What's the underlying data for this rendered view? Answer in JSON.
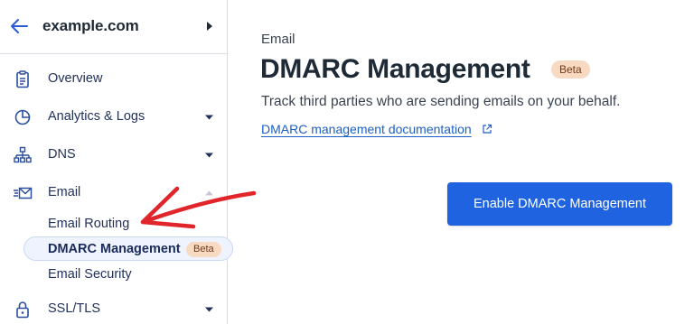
{
  "sidebar": {
    "account_name": "example.com",
    "icons": {
      "back": "arrow-left-icon",
      "switch": "caret-right-icon"
    },
    "items": [
      {
        "id": "overview",
        "label": "Overview",
        "icon": "clipboard-icon",
        "has_chevron": false
      },
      {
        "id": "analytics",
        "label": "Analytics & Logs",
        "icon": "pie-chart-icon",
        "has_chevron": true
      },
      {
        "id": "dns",
        "label": "DNS",
        "icon": "network-icon",
        "has_chevron": true
      },
      {
        "id": "email",
        "label": "Email",
        "icon": "envelope-icon",
        "has_chevron": true,
        "expanded": true
      },
      {
        "id": "ssl",
        "label": "SSL/TLS",
        "icon": "lock-icon",
        "has_chevron": true
      }
    ],
    "email_subitems": [
      {
        "label": "Email Routing",
        "active": false
      },
      {
        "label": "DMARC Management",
        "active": true,
        "badge": "Beta"
      },
      {
        "label": "Email Security",
        "active": false
      }
    ]
  },
  "main": {
    "eyebrow": "Email",
    "title": "DMARC Management",
    "title_badge": "Beta",
    "description": "Track third parties who are sending emails on your behalf.",
    "doc_link": "DMARC management documentation",
    "enable_button": "Enable DMARC Management"
  },
  "colors": {
    "accent": "#1f63e0",
    "link": "#1c5fc6",
    "badge_bg": "#f8d9c2",
    "annotation_arrow": "#e0262b",
    "active_bg": "#eef3fd"
  }
}
